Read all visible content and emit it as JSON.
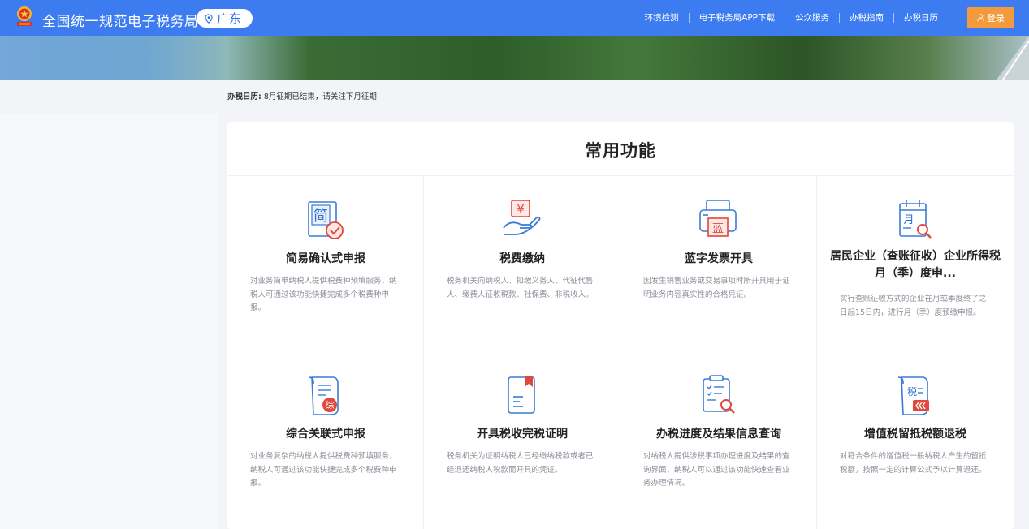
{
  "header": {
    "site_title": "全国统一规范电子税务局",
    "region": "广东",
    "nav": [
      "环境检测",
      "电子税务局APP下载",
      "公众服务",
      "办税指南",
      "办税日历"
    ],
    "login_label": "登录",
    "brand_color": "#3d7cf0",
    "login_color": "#f39a3c"
  },
  "calendar": {
    "label": "办税日历:",
    "text": "8月征期已结束，请关注下月征期"
  },
  "main": {
    "section_title": "常用功能",
    "functions": [
      {
        "title": "简易确认式申报",
        "icon": "simple-declare-icon",
        "desc": "对业务简单纳税人提供税费种预填服务，纳税人可通过该功能快捷完成多个税费种申报。"
      },
      {
        "title": "税费缴纳",
        "icon": "tax-payment-icon",
        "desc": "税务机关向纳税人、扣缴义务人、代征代售人、缴费人征收税款、社保费、非税收入。"
      },
      {
        "title": "蓝字发票开具",
        "icon": "blue-invoice-icon",
        "desc": "因发生销售业务或交易事项时所开具用于证明业务内容真实性的合格凭证。"
      },
      {
        "title": "居民企业（查账征收）企业所得税月（季）度申...",
        "icon": "corporate-tax-icon",
        "desc": "实行查账征收方式的企业在月或季度终了之日起15日内，进行月（季）度预缴申报。"
      },
      {
        "title": "综合关联式申报",
        "icon": "comprehensive-declare-icon",
        "desc": "对业务复杂的纳税人提供税费种预填服务，纳税人可通过该功能快捷完成多个税费种申报。"
      },
      {
        "title": "开具税收完税证明",
        "icon": "tax-certificate-icon",
        "desc": "税务机关为证明纳税人已经缴纳税款或者已经退还纳税人税款而开具的凭证。"
      },
      {
        "title": "办税进度及结果信息查询",
        "icon": "progress-query-icon",
        "desc": "对纳税人提供涉税事项办理进度及结果的查询界面，纳税人可以通过该功能快速查看业务办理情况。"
      },
      {
        "title": "增值税留抵税额退税",
        "icon": "vat-refund-icon",
        "desc": "对符合条件的增值税一般纳税人产生的留抵税额，按照一定的计算公式予以计算退还。"
      }
    ]
  },
  "icon_glyphs": {
    "simple": "简",
    "payment": "¥",
    "invoice": "蓝",
    "month": "月",
    "comprehensive": "综",
    "tax": "税"
  }
}
